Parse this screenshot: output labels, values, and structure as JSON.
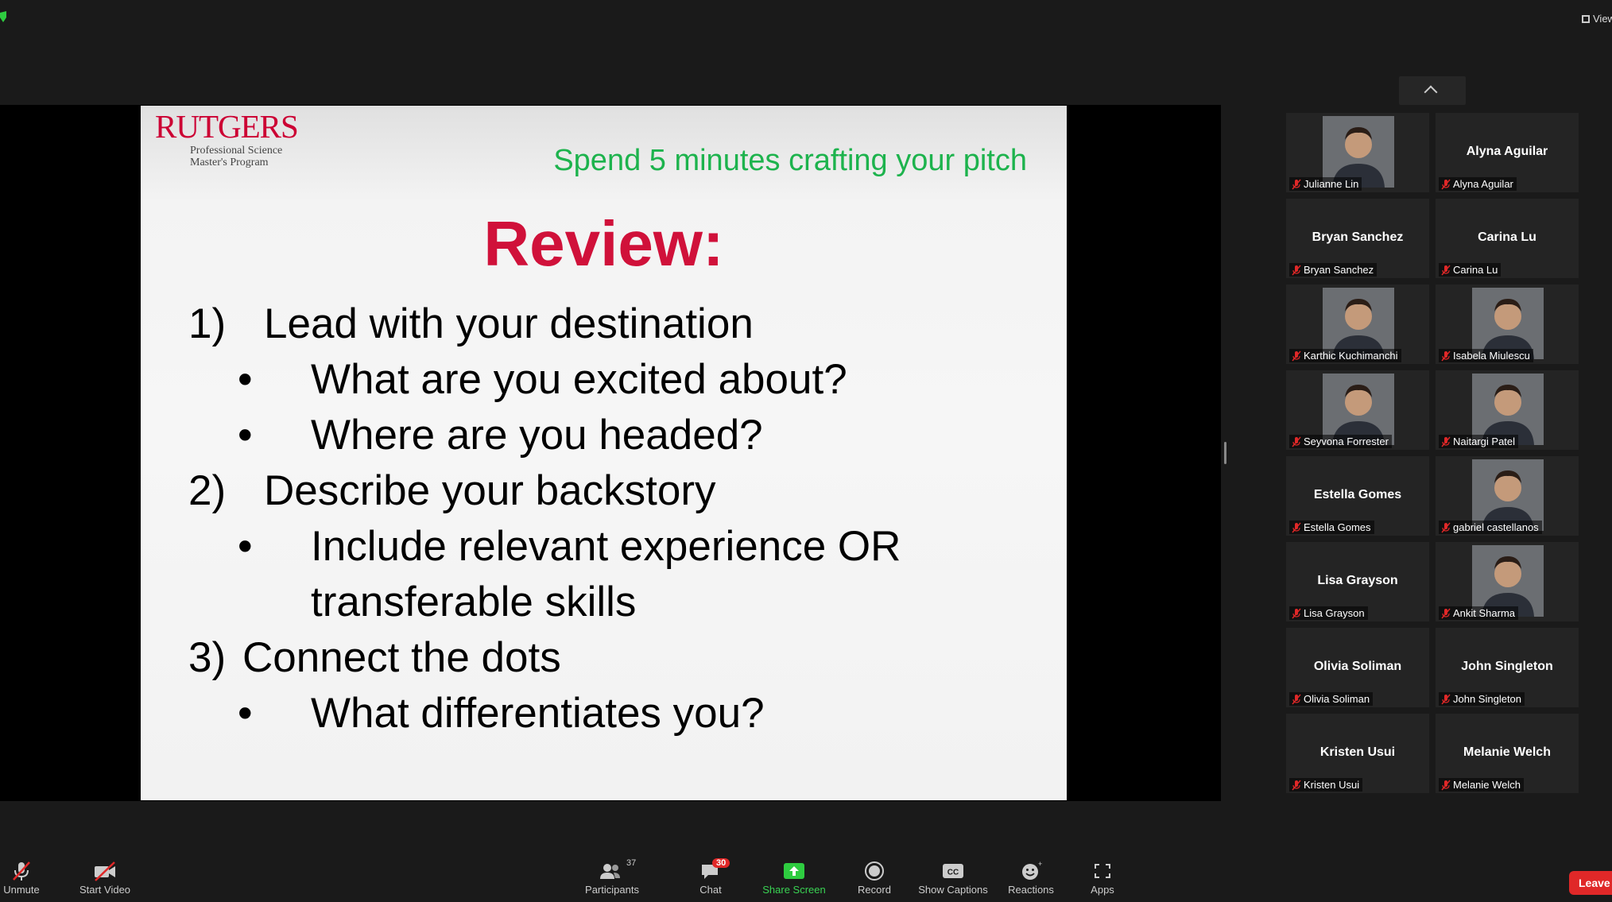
{
  "window": {
    "view_button_label": "View"
  },
  "slide": {
    "logo_word": "RUTGERS",
    "logo_line1": "Professional Science",
    "logo_line2": "Master's Program",
    "banner": "Spend 5 minutes crafting your pitch",
    "title": "Review:",
    "items": [
      {
        "num": "1)",
        "text": "Lead with your destination"
      },
      {
        "bullet": "•",
        "text": "What are you excited about?"
      },
      {
        "bullet": "•",
        "text": "Where are you headed?"
      },
      {
        "num": "2)",
        "text": "Describe your backstory"
      },
      {
        "bullet": "•",
        "text": "Include relevant experience OR"
      },
      {
        "cont": true,
        "text": "transferable skills"
      },
      {
        "num": "3)",
        "text": "Connect the dots"
      },
      {
        "bullet": "•",
        "text": "What differentiates you?"
      }
    ]
  },
  "participants_panel": {
    "tiles": [
      {
        "center_name": "",
        "label": "Julianne Lin",
        "has_photo": true
      },
      {
        "center_name": "Alyna Aguilar",
        "label": "Alyna Aguilar",
        "has_photo": false
      },
      {
        "center_name": "Bryan Sanchez",
        "label": "Bryan Sanchez",
        "has_photo": false
      },
      {
        "center_name": "Carina Lu",
        "label": "Carina Lu",
        "has_photo": false
      },
      {
        "center_name": "",
        "label": "Karthic Kuchimanchi",
        "has_photo": true
      },
      {
        "center_name": "",
        "label": "Isabela Miulescu",
        "has_photo": true
      },
      {
        "center_name": "",
        "label": "Seyvona Forrester",
        "has_photo": true
      },
      {
        "center_name": "",
        "label": "Naitargi Patel",
        "has_photo": true
      },
      {
        "center_name": "Estella Gomes",
        "label": "Estella Gomes",
        "has_photo": false
      },
      {
        "center_name": "",
        "label": "gabriel castellanos",
        "has_photo": true
      },
      {
        "center_name": "Lisa Grayson",
        "label": "Lisa Grayson",
        "has_photo": false
      },
      {
        "center_name": "",
        "label": "Ankit Sharma",
        "has_photo": true
      },
      {
        "center_name": "Olivia Soliman",
        "label": "Olivia Soliman",
        "has_photo": false
      },
      {
        "center_name": "John Singleton",
        "label": "John Singleton",
        "has_photo": false
      },
      {
        "center_name": "Kristen Usui",
        "label": "Kristen Usui",
        "has_photo": false
      },
      {
        "center_name": "Melanie Welch",
        "label": "Melanie Welch",
        "has_photo": false
      }
    ]
  },
  "toolbar": {
    "unmute": "Unmute",
    "start_video": "Start Video",
    "participants": "Participants",
    "participants_count": "37",
    "chat": "Chat",
    "chat_badge": "30",
    "share_screen": "Share Screen",
    "record": "Record",
    "show_captions": "Show Captions",
    "reactions": "Reactions",
    "apps": "Apps",
    "leave": "Leave"
  },
  "colors": {
    "rutgers_red": "#cc0033",
    "title_red": "#d0113a",
    "banner_green": "#1db34d",
    "share_green": "#39d353",
    "leave_red": "#e02828"
  }
}
